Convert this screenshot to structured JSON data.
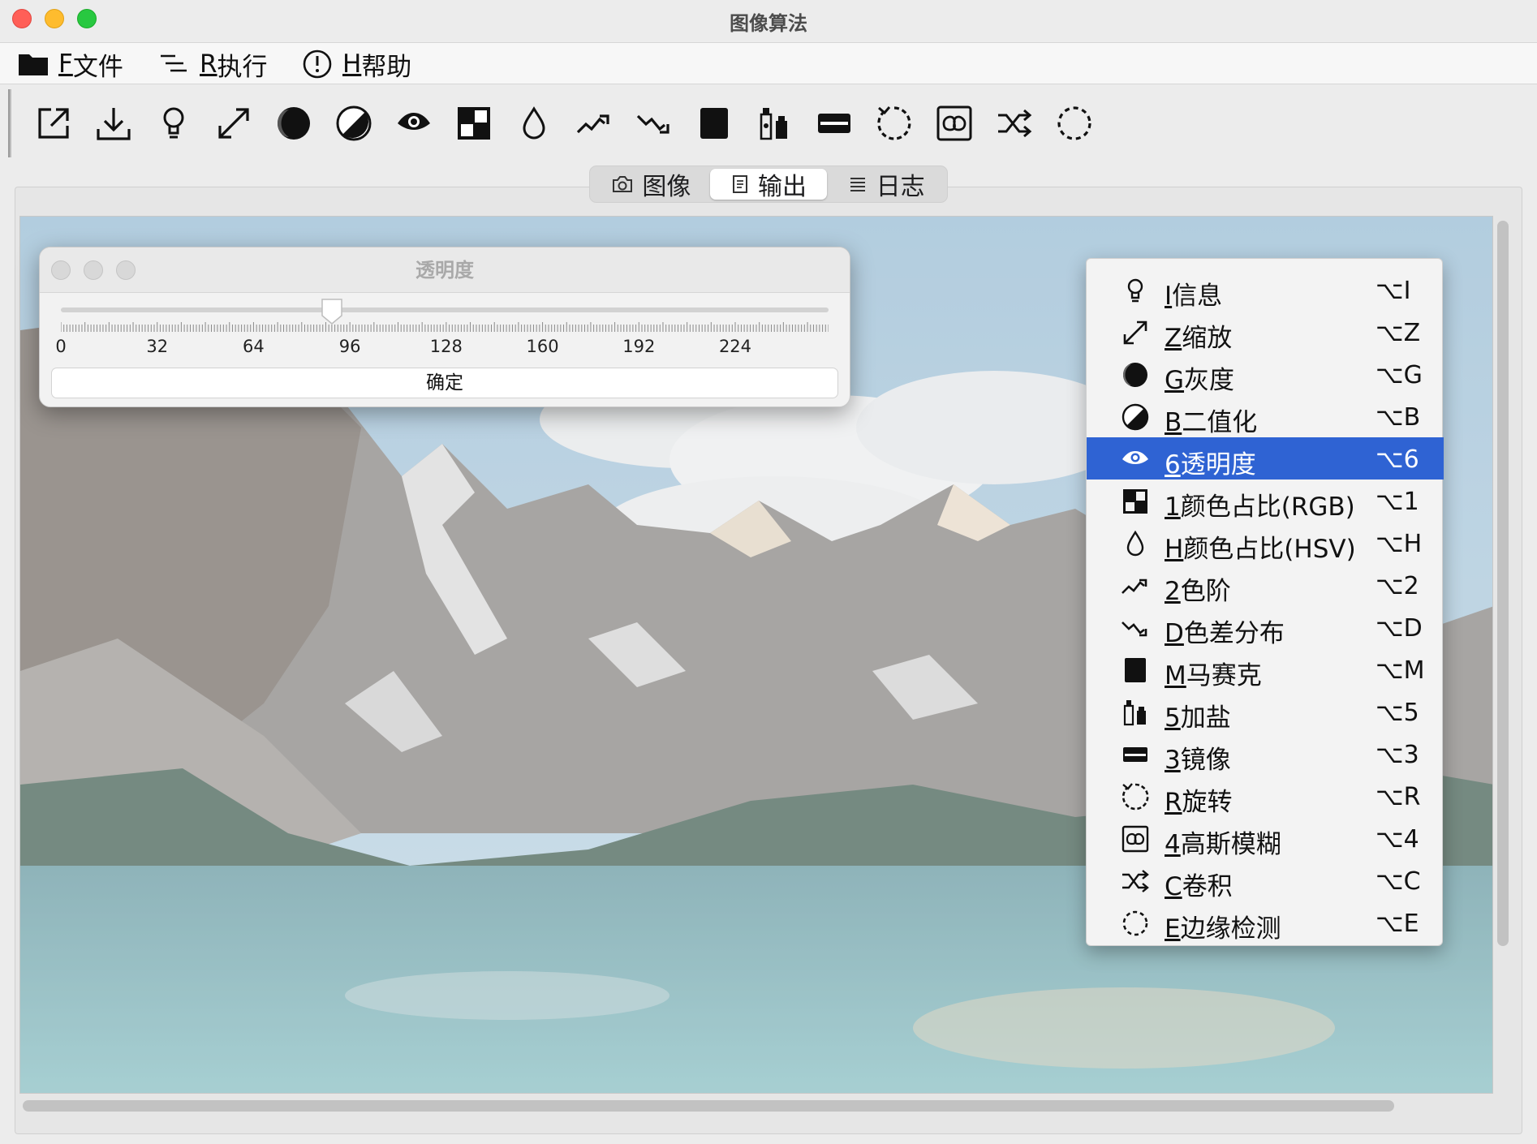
{
  "window": {
    "title": "图像算法"
  },
  "menubar": {
    "items": [
      {
        "key": "F",
        "label": "文件"
      },
      {
        "key": "R",
        "label": "执行"
      },
      {
        "key": "H",
        "label": "帮助"
      }
    ]
  },
  "toolbar": {
    "tools": [
      "export-icon",
      "download-icon",
      "lightbulb-icon",
      "resize-icon",
      "grayscale-icon",
      "binarize-icon",
      "eye-icon",
      "grid-icon",
      "drop-icon",
      "trend-up-icon",
      "trend-down-icon",
      "mosaic-icon",
      "salt-icon",
      "mirror-icon",
      "rotate-icon",
      "blur-icon",
      "shuffle-icon",
      "edge-icon"
    ]
  },
  "tabs": [
    {
      "label": "图像",
      "icon": "camera-icon",
      "active": false
    },
    {
      "label": "输出",
      "icon": "document-icon",
      "active": true
    },
    {
      "label": "日志",
      "icon": "list-icon",
      "active": false
    }
  ],
  "dialog": {
    "title": "透明度",
    "slider_value": 90,
    "slider_max": 255,
    "tick_labels": [
      "0",
      "32",
      "64",
      "96",
      "128",
      "160",
      "192",
      "224"
    ],
    "ok_label": "确定"
  },
  "context_menu": {
    "selected_index": 4,
    "items": [
      {
        "key": "I",
        "label": "信息",
        "shortcut": "⌥I",
        "icon": "lightbulb-icon"
      },
      {
        "key": "Z",
        "label": "缩放",
        "shortcut": "⌥Z",
        "icon": "resize-icon"
      },
      {
        "key": "G",
        "label": "灰度",
        "shortcut": "⌥G",
        "icon": "grayscale-icon"
      },
      {
        "key": "B",
        "label": "二值化",
        "shortcut": "⌥B",
        "icon": "binarize-icon"
      },
      {
        "key": "6",
        "label": "透明度",
        "shortcut": "⌥6",
        "icon": "eye-icon"
      },
      {
        "key": "1",
        "label": "颜色占比(RGB)",
        "shortcut": "⌥1",
        "icon": "grid-icon"
      },
      {
        "key": "H",
        "label": "颜色占比(HSV)",
        "shortcut": "⌥H",
        "icon": "drop-icon"
      },
      {
        "key": "2",
        "label": "色阶",
        "shortcut": "⌥2",
        "icon": "trend-up-icon"
      },
      {
        "key": "D",
        "label": "色差分布",
        "shortcut": "⌥D",
        "icon": "trend-down-icon"
      },
      {
        "key": "M",
        "label": "马赛克",
        "shortcut": "⌥M",
        "icon": "mosaic-icon"
      },
      {
        "key": "5",
        "label": "加盐",
        "shortcut": "⌥5",
        "icon": "salt-icon"
      },
      {
        "key": "3",
        "label": "镜像",
        "shortcut": "⌥3",
        "icon": "mirror-icon"
      },
      {
        "key": "R",
        "label": "旋转",
        "shortcut": "⌥R",
        "icon": "rotate-icon"
      },
      {
        "key": "4",
        "label": "高斯模糊",
        "shortcut": "⌥4",
        "icon": "blur-icon"
      },
      {
        "key": "C",
        "label": "卷积",
        "shortcut": "⌥C",
        "icon": "shuffle-icon"
      },
      {
        "key": "E",
        "label": "边缘检测",
        "shortcut": "⌥E",
        "icon": "edge-icon"
      }
    ]
  },
  "colors": {
    "selection": "#2f63d3",
    "sky": "#a9c7dc",
    "lake": "#7fb5bd",
    "mountain": "#9c9a98"
  }
}
